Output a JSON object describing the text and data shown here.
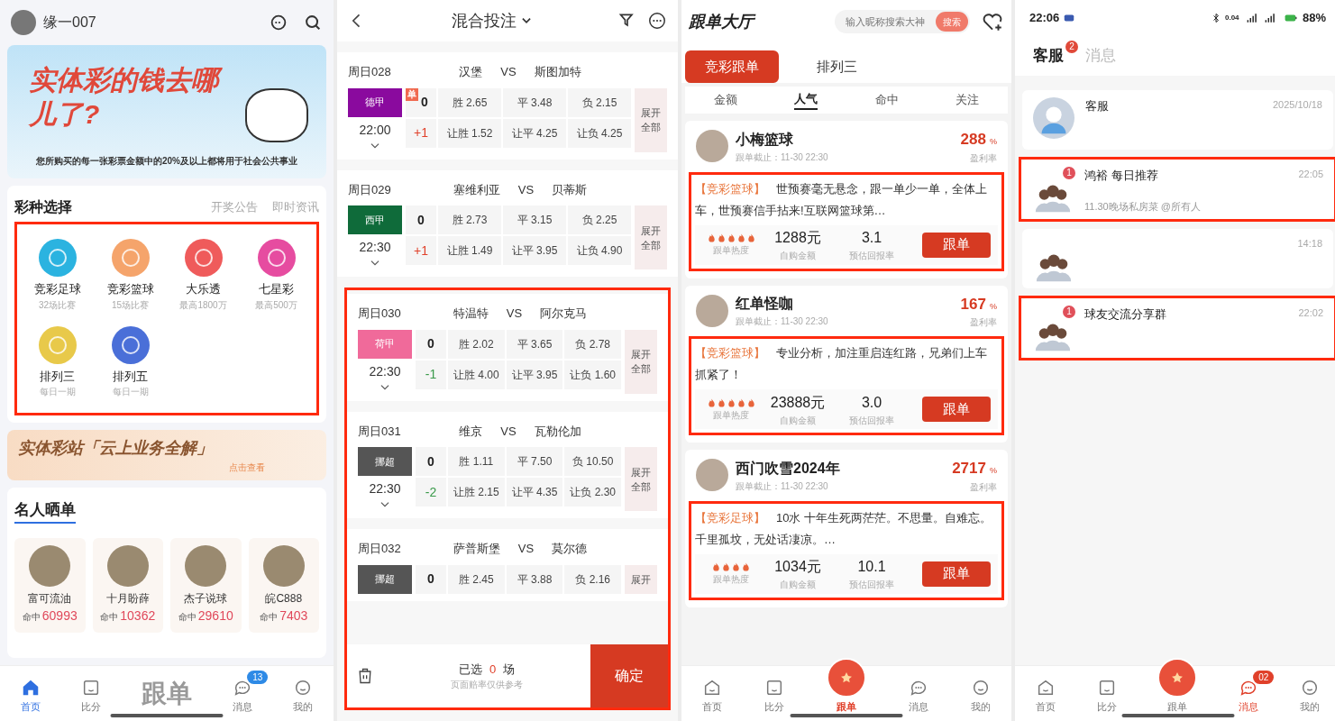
{
  "home": {
    "user": {
      "name": "缘一007"
    },
    "banner": {
      "headline": "实体彩的钱去哪儿了?",
      "caption": "您所购买的每一张彩票金额中的20%及以上都将用于社会公共事业"
    },
    "lottery_section": {
      "title": "彩种选择",
      "links": [
        "开奖公告",
        "即时资讯"
      ],
      "highlighted": true,
      "items": [
        {
          "name": "竞彩足球",
          "sub": "32场比赛",
          "color": "#2bb3e0"
        },
        {
          "name": "竞彩篮球",
          "sub": "15场比赛",
          "color": "#f5a46b"
        },
        {
          "name": "大乐透",
          "sub": "最高1800万",
          "color": "#ef5b5b"
        },
        {
          "name": "七星彩",
          "sub": "最高500万",
          "color": "#e64ca0"
        },
        {
          "name": "排列三",
          "sub": "每日一期",
          "color": "#e8c94a"
        },
        {
          "name": "排列五",
          "sub": "每日一期",
          "color": "#4a6fd8"
        }
      ]
    },
    "promo": {
      "title": "实体彩站「云上业务全解」",
      "action": "点击查看"
    },
    "celebrities": {
      "title": "名人晒单",
      "items": [
        {
          "name": "富可流油",
          "hit_label": "命中",
          "hits": "60993"
        },
        {
          "name": "十月盼薛",
          "hit_label": "命中",
          "hits": "10362"
        },
        {
          "name": "杰子说球",
          "hit_label": "命中",
          "hits": "29610"
        },
        {
          "name": "皖C888",
          "hit_label": "命中",
          "hits": "7403"
        }
      ]
    },
    "nav": [
      {
        "kind": "tab",
        "label": "首页",
        "selected": true
      },
      {
        "kind": "tab",
        "label": "比分",
        "selected": false
      },
      {
        "kind": "center",
        "label": "跟单",
        "selected": false
      },
      {
        "kind": "tab",
        "label": "消息",
        "selected": false,
        "badge": "13"
      },
      {
        "kind": "tab",
        "label": "我的",
        "selected": false
      }
    ]
  },
  "betting": {
    "title": "混合投注",
    "matches": [
      {
        "id": "周日028",
        "home": "汉堡",
        "vs": "VS",
        "away": "斯图加特",
        "league": "德甲",
        "color": "#8a0a9e",
        "time": "22:00",
        "single_badge": "单",
        "lines": [
          {
            "handicap": "0",
            "kind": "none",
            "odds": [
              "胜 2.65",
              "平 3.48",
              "负 2.15"
            ]
          },
          {
            "handicap": "+1",
            "kind": "plus",
            "odds": [
              "让胜 1.52",
              "让平 4.25",
              "让负 4.25"
            ]
          }
        ],
        "expand": "展开全部",
        "highlighted": false
      },
      {
        "id": "周日029",
        "home": "塞维利亚",
        "vs": "VS",
        "away": "贝蒂斯",
        "league": "西甲",
        "color": "#0f6b3a",
        "time": "22:30",
        "lines": [
          {
            "handicap": "0",
            "kind": "none",
            "odds": [
              "胜 2.73",
              "平 3.15",
              "负 2.25"
            ]
          },
          {
            "handicap": "+1",
            "kind": "plus",
            "odds": [
              "让胜 1.49",
              "让平 3.95",
              "让负 4.90"
            ]
          }
        ],
        "expand": "展开全部",
        "highlighted": false
      },
      {
        "id": "周日030",
        "home": "特温特",
        "vs": "VS",
        "away": "阿尔克马",
        "league": "荷甲",
        "color": "#f06a9a",
        "time": "22:30",
        "lines": [
          {
            "handicap": "0",
            "kind": "none",
            "odds": [
              "胜 2.02",
              "平 3.65",
              "负 2.78"
            ]
          },
          {
            "handicap": "-1",
            "kind": "minus",
            "odds": [
              "让胜 4.00",
              "让平 3.95",
              "让负 1.60"
            ]
          }
        ],
        "expand": "展开全部",
        "highlighted": true
      },
      {
        "id": "周日031",
        "home": "维京",
        "vs": "VS",
        "away": "瓦勒伦加",
        "league": "挪超",
        "color": "#555555",
        "time": "22:30",
        "lines": [
          {
            "handicap": "0",
            "kind": "none",
            "odds": [
              "胜 1.11",
              "平 7.50",
              "负 10.50"
            ]
          },
          {
            "handicap": "-2",
            "kind": "minus",
            "odds": [
              "让胜 2.15",
              "让平 4.35",
              "让负 2.30"
            ]
          }
        ],
        "expand": "展开全部",
        "highlighted": true
      },
      {
        "id": "周日032",
        "home": "萨普斯堡",
        "vs": "VS",
        "away": "莫尔德",
        "league": "挪超",
        "color": "#555555",
        "lines": [
          {
            "handicap": "0",
            "kind": "none",
            "odds": [
              "胜 2.45",
              "平 3.88",
              "负 2.16"
            ]
          }
        ],
        "expand": "展开",
        "highlighted": true
      }
    ],
    "footer": {
      "selected_prefix": "已选",
      "selected_count": "0",
      "selected_suffix": "场",
      "note": "页面赔率仅供参考",
      "confirm": "确定",
      "highlighted": true
    }
  },
  "follow": {
    "title": "跟单大厅",
    "search": {
      "placeholder": "输入昵称搜索大神",
      "button": "搜索"
    },
    "tabs": [
      {
        "label": "竞彩跟单",
        "selected": true
      },
      {
        "label": "排列三",
        "selected": false
      }
    ],
    "sort_tabs": [
      {
        "label": "金额",
        "selected": false
      },
      {
        "label": "人气",
        "selected": true
      },
      {
        "label": "命中",
        "selected": false
      },
      {
        "label": "关注",
        "selected": false
      }
    ],
    "posts": [
      {
        "name": "小梅篮球",
        "deadline": "跟单截止：11-30 22:30",
        "rate": "288",
        "rate_unit": "%",
        "rate_label": "盈利率",
        "tag": "【竞彩篮球】",
        "text": "世预赛毫无悬念，跟一单少一单，全体上车，世预赛信手拈来!互联网篮球第…",
        "stars": 5,
        "heat_label": "跟单热度",
        "amount": "1288元",
        "amount_label": "自购金额",
        "return": "3.1",
        "return_label": "预估回报率",
        "button": "跟单",
        "highlighted": true
      },
      {
        "name": "红单怪咖",
        "deadline": "跟单截止：11-30 22:30",
        "rate": "167",
        "rate_unit": "%",
        "rate_label": "盈利率",
        "tag": "【竞彩篮球】",
        "text": "专业分析，加注重启连红路，兄弟们上车抓紧了！",
        "stars": 5,
        "heat_label": "跟单热度",
        "amount": "23888元",
        "amount_label": "自购金额",
        "return": "3.0",
        "return_label": "预估回报率",
        "button": "跟单",
        "highlighted": true
      },
      {
        "name": "西门吹雪2024年",
        "deadline": "跟单截止：11-30 22:30",
        "rate": "2717",
        "rate_unit": "%",
        "rate_label": "盈利率",
        "tag": "【竞彩足球】",
        "text": "10水 十年生死两茫茫。不思量。自难忘。千里孤坟，无处话凄凉。…",
        "stars": 4,
        "heat_label": "跟单热度",
        "amount": "1034元",
        "amount_label": "自购金额",
        "return": "10.1",
        "return_label": "预估回报率",
        "button": "跟单",
        "highlighted": true
      }
    ],
    "nav": [
      {
        "kind": "tab",
        "label": "首页",
        "selected": false
      },
      {
        "kind": "tab",
        "label": "比分",
        "selected": false
      },
      {
        "kind": "center",
        "label": "跟单",
        "selected": true
      },
      {
        "kind": "tab",
        "label": "消息",
        "selected": false
      },
      {
        "kind": "tab",
        "label": "我的",
        "selected": false
      }
    ]
  },
  "messages": {
    "status_bar": {
      "time": "22:06",
      "net_speed": "0.04",
      "battery": "88%"
    },
    "tabs": [
      {
        "label": "客服",
        "selected": true,
        "badge": "2"
      },
      {
        "label": "消息",
        "selected": false
      }
    ],
    "rows": [
      {
        "title": "客服",
        "time": "2025/10/18",
        "kind": "service",
        "highlighted": false
      },
      {
        "title": "鸿裕 每日推荐",
        "time": "22:05",
        "preview": "11.30晚场私房菜 @所有人",
        "badge": "1",
        "kind": "group",
        "highlighted": true
      },
      {
        "time": "14:18",
        "kind": "group",
        "highlighted": false
      },
      {
        "title": "球友交流分享群",
        "time": "22:02",
        "badge": "1",
        "kind": "group",
        "highlighted": true
      }
    ],
    "nav": [
      {
        "kind": "tab",
        "label": "首页",
        "selected": false
      },
      {
        "kind": "tab",
        "label": "比分",
        "selected": false
      },
      {
        "kind": "center",
        "label": "跟单",
        "selected": false
      },
      {
        "kind": "tab",
        "label": "消息",
        "selected": true,
        "badge": "02"
      },
      {
        "kind": "tab",
        "label": "我的",
        "selected": false
      }
    ]
  }
}
